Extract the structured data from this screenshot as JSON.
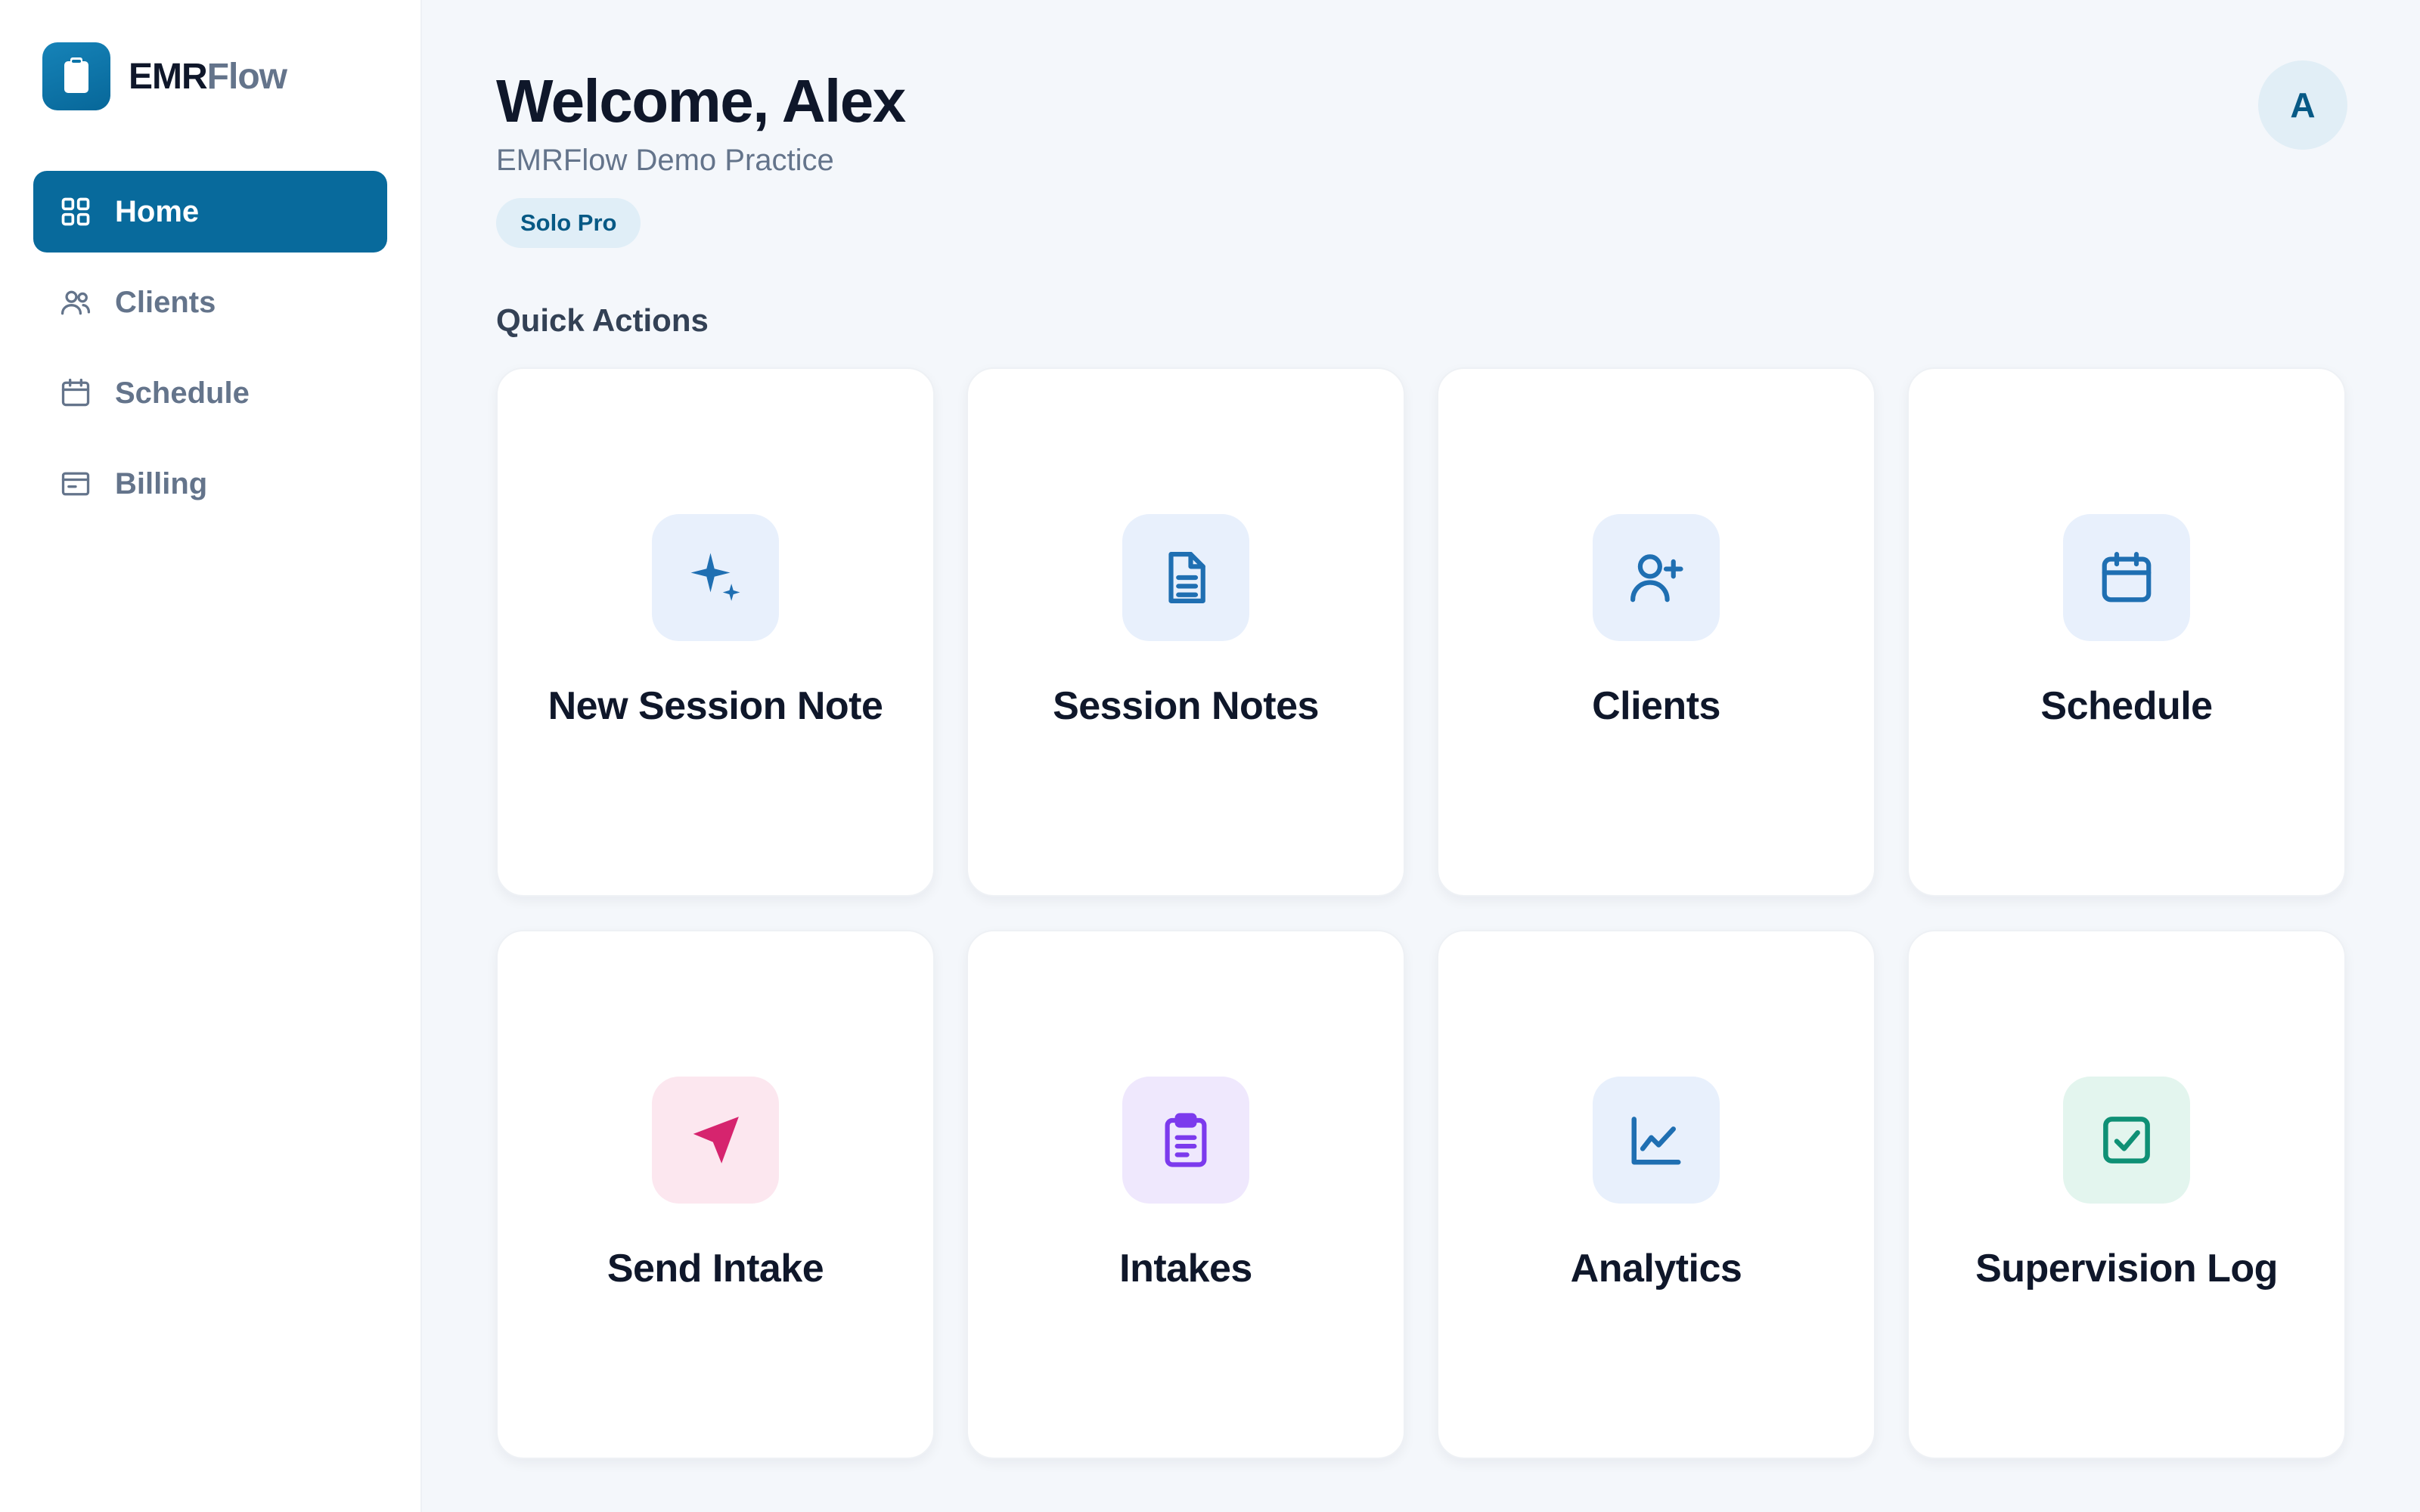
{
  "brand": {
    "name_part1": "EMR",
    "name_part2": "Flow",
    "icon": "clipboard-icon"
  },
  "sidebar": {
    "items": [
      {
        "label": "Home",
        "icon": "grid-icon",
        "active": true
      },
      {
        "label": "Clients",
        "icon": "users-icon",
        "active": false
      },
      {
        "label": "Schedule",
        "icon": "calendar-icon",
        "active": false
      },
      {
        "label": "Billing",
        "icon": "billing-icon",
        "active": false
      }
    ]
  },
  "header": {
    "welcome": "Welcome, Alex",
    "practice": "EMRFlow Demo Practice",
    "plan": "Solo Pro",
    "avatar_initial": "A"
  },
  "quick_actions": {
    "title": "Quick Actions",
    "cards": [
      {
        "label": "New Session Note",
        "icon": "sparkle-icon",
        "color": "#1f6fb2",
        "bg": "#e8f0fc"
      },
      {
        "label": "Session Notes",
        "icon": "document-icon",
        "color": "#1f6fb2",
        "bg": "#e8f0fc"
      },
      {
        "label": "Clients",
        "icon": "user-plus-icon",
        "color": "#1f6fb2",
        "bg": "#e8f0fc"
      },
      {
        "label": "Schedule",
        "icon": "calendar-icon",
        "color": "#1f6fb2",
        "bg": "#e8f0fc"
      },
      {
        "label": "Send Intake",
        "icon": "send-icon",
        "color": "#d6246e",
        "bg": "#fce7ef"
      },
      {
        "label": "Intakes",
        "icon": "clipboard-list-icon",
        "color": "#7c3aed",
        "bg": "#efe8fd"
      },
      {
        "label": "Analytics",
        "icon": "chart-line-icon",
        "color": "#1f6fb2",
        "bg": "#e8f0fc"
      },
      {
        "label": "Supervision Log",
        "icon": "check-square-icon",
        "color": "#0f9075",
        "bg": "#e3f5ee"
      }
    ]
  },
  "colors": {
    "accent": "#086a9c",
    "background": "#f4f7fb"
  }
}
